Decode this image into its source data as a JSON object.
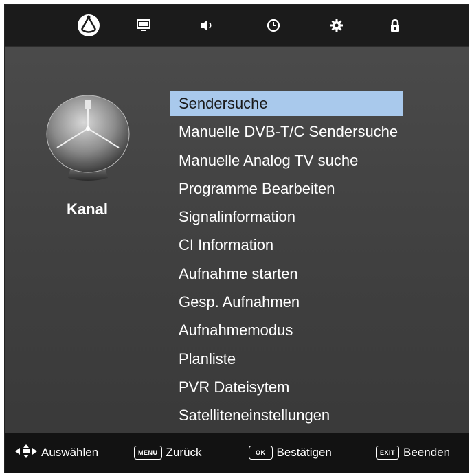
{
  "top_tabs": [
    {
      "icon": "channel-dish-icon",
      "active": true
    },
    {
      "icon": "picture-monitor-icon",
      "active": false
    },
    {
      "icon": "sound-speaker-icon",
      "active": false
    },
    {
      "icon": "time-clock-icon",
      "active": false
    },
    {
      "icon": "setup-gear-icon",
      "active": false
    },
    {
      "icon": "lock-icon",
      "active": false
    }
  ],
  "category": {
    "label": "Kanal",
    "icon": "satellite-dish-icon"
  },
  "menu": {
    "selected_index": 0,
    "items": [
      "Sendersuche",
      "Manuelle DVB-T/C Sendersuche",
      "Manuelle Analog TV suche",
      "Programme Bearbeiten",
      "Signalinformation",
      "CI Information",
      "Aufnahme starten",
      "Gesp. Aufnahmen",
      "Aufnahmemodus",
      "Planliste",
      "PVR Dateisytem",
      "Satelliteneinstellungen"
    ]
  },
  "footer": {
    "select_label": "Auswählen",
    "menu_key": "MENU",
    "back_label": "Zurück",
    "ok_key": "OK",
    "confirm_label": "Bestätigen",
    "exit_key": "EXIT",
    "exit_label": "Beenden"
  },
  "colors": {
    "highlight": "#a9c9ec",
    "bar": "#1b1b1b",
    "background": "#444444"
  }
}
